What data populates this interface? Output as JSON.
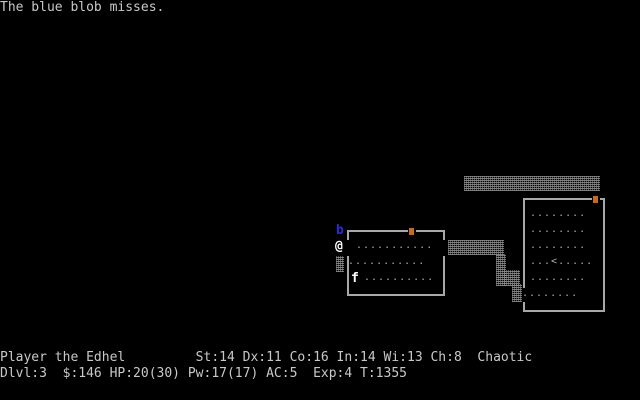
{
  "message_line": "The blue blob misses.",
  "status": {
    "line1": "Player the Edhel         St:14 Dx:11 Co:16 In:14 Wi:13 Ch:8  Chaotic",
    "line2": "Dlvl:3  $:146 HP:20(30) Pw:17(17) AC:5  Exp:4 T:1355"
  },
  "map": {
    "player": "@",
    "blue_blob": "b",
    "pet_kitten": "f",
    "up_staircase": "<",
    "room1_rows": [
      "...........",
      "...........",
      ".........."
    ],
    "room2_rows": [
      "........",
      "........",
      "........",
      "...<.....",
      "........",
      "........"
    ]
  },
  "colors": {
    "background": "#000000",
    "text": "#c8c8c8",
    "door": "#c86a18",
    "blue_blob": "#2a2ad8",
    "player": "#ffffff",
    "kitten": "#ffffff"
  }
}
